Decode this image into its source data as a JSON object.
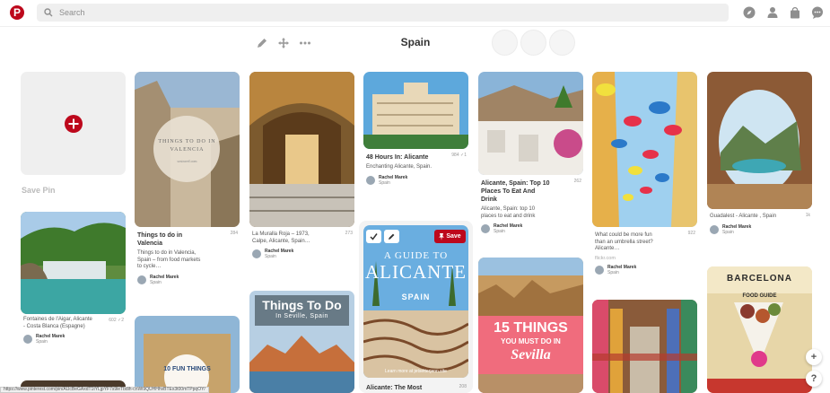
{
  "header": {
    "logo_letter": "P",
    "search_placeholder": "Search",
    "icons": [
      "explore-icon",
      "profile-icon",
      "shop-icon",
      "messages-icon"
    ]
  },
  "board": {
    "title": "Spain",
    "tools": [
      "edit-icon",
      "move-icon",
      "more-icon"
    ]
  },
  "save_pin": {
    "label": "Save Pin"
  },
  "pins": {
    "valencia_things": {
      "overlay_line1": "THINGS TO DO IN",
      "overlay_line2": "VALENCIA",
      "overlay_site": "sostravel.com",
      "title": "Things to do in Valencia",
      "stat": "284",
      "desc": "Things to do in Valencia, Spain – from food markets to cycle…",
      "author": "Rachel Marek",
      "board": "Spain"
    },
    "muralla": {
      "title": "",
      "stat": "273",
      "desc": "La Muralla Roja – 1973, Calpe, Alicante, Spain…",
      "author": "Rachel Marek",
      "board": "Spain"
    },
    "alicante48": {
      "title": "48 Hours In: Alicante",
      "stat": "984",
      "stat2": "1",
      "desc": "Enchanting Alicante, Spain.",
      "author": "Rachel Marek",
      "board": "Spain"
    },
    "alicante_top10": {
      "title": "Alicante, Spain: Top 10 Places To Eat And Drink",
      "stat": "262",
      "desc": "Alicante, Spain: top 10 places to eat and drink",
      "author": "Rachel Marek",
      "board": "Spain"
    },
    "umbrella": {
      "stat": "922",
      "desc": "What could be more fun than an umbrella street? Alicante…",
      "source": "flickr.com",
      "author": "Rachel Marek",
      "board": "Spain"
    },
    "guadalest": {
      "stat": "1k",
      "desc": "Guadalest - Alicante , Spain",
      "author": "Rachel Marek",
      "board": "Spain"
    },
    "aigar": {
      "stat": "602",
      "stat2": "2",
      "desc": "Fontaines de l'Aigar, Alicante - Costa Blanca (Espagne)",
      "author": "Rachel Marek",
      "board": "Spain"
    },
    "alicante_guide": {
      "overlay_line1": "A GUIDE TO",
      "overlay_line2": "ALICANTE",
      "overlay_line3": "SPAIN",
      "overlay_foot": "Learn more at jetsetterjenn.site",
      "save_label": "Save",
      "title": "Alicante: The Most",
      "stat": "208"
    },
    "seville_things": {
      "overlay_line1": "Things To Do",
      "overlay_line2": "In Seville, Spain"
    },
    "seville15": {
      "overlay_line1": "15 THINGS",
      "overlay_line2": "YOU MUST DO IN",
      "overlay_line3": "Sevilla"
    },
    "valencia10": {
      "overlay_line1": "10 FUN THINGS"
    },
    "barcelona": {
      "overlay_line1": "BARCELONA",
      "overlay_line2": "FOOD GUIDE"
    }
  },
  "status_url": "https://www.pinterest.com/pin/AUcBeGAxdT1tYLjpYF7s9leTbdih-cnWi9QUHHhvBTEx3t00mTPpqOY/",
  "floating": {
    "add": "+",
    "help": "?"
  },
  "colors": {
    "brand": "#bd081c"
  }
}
